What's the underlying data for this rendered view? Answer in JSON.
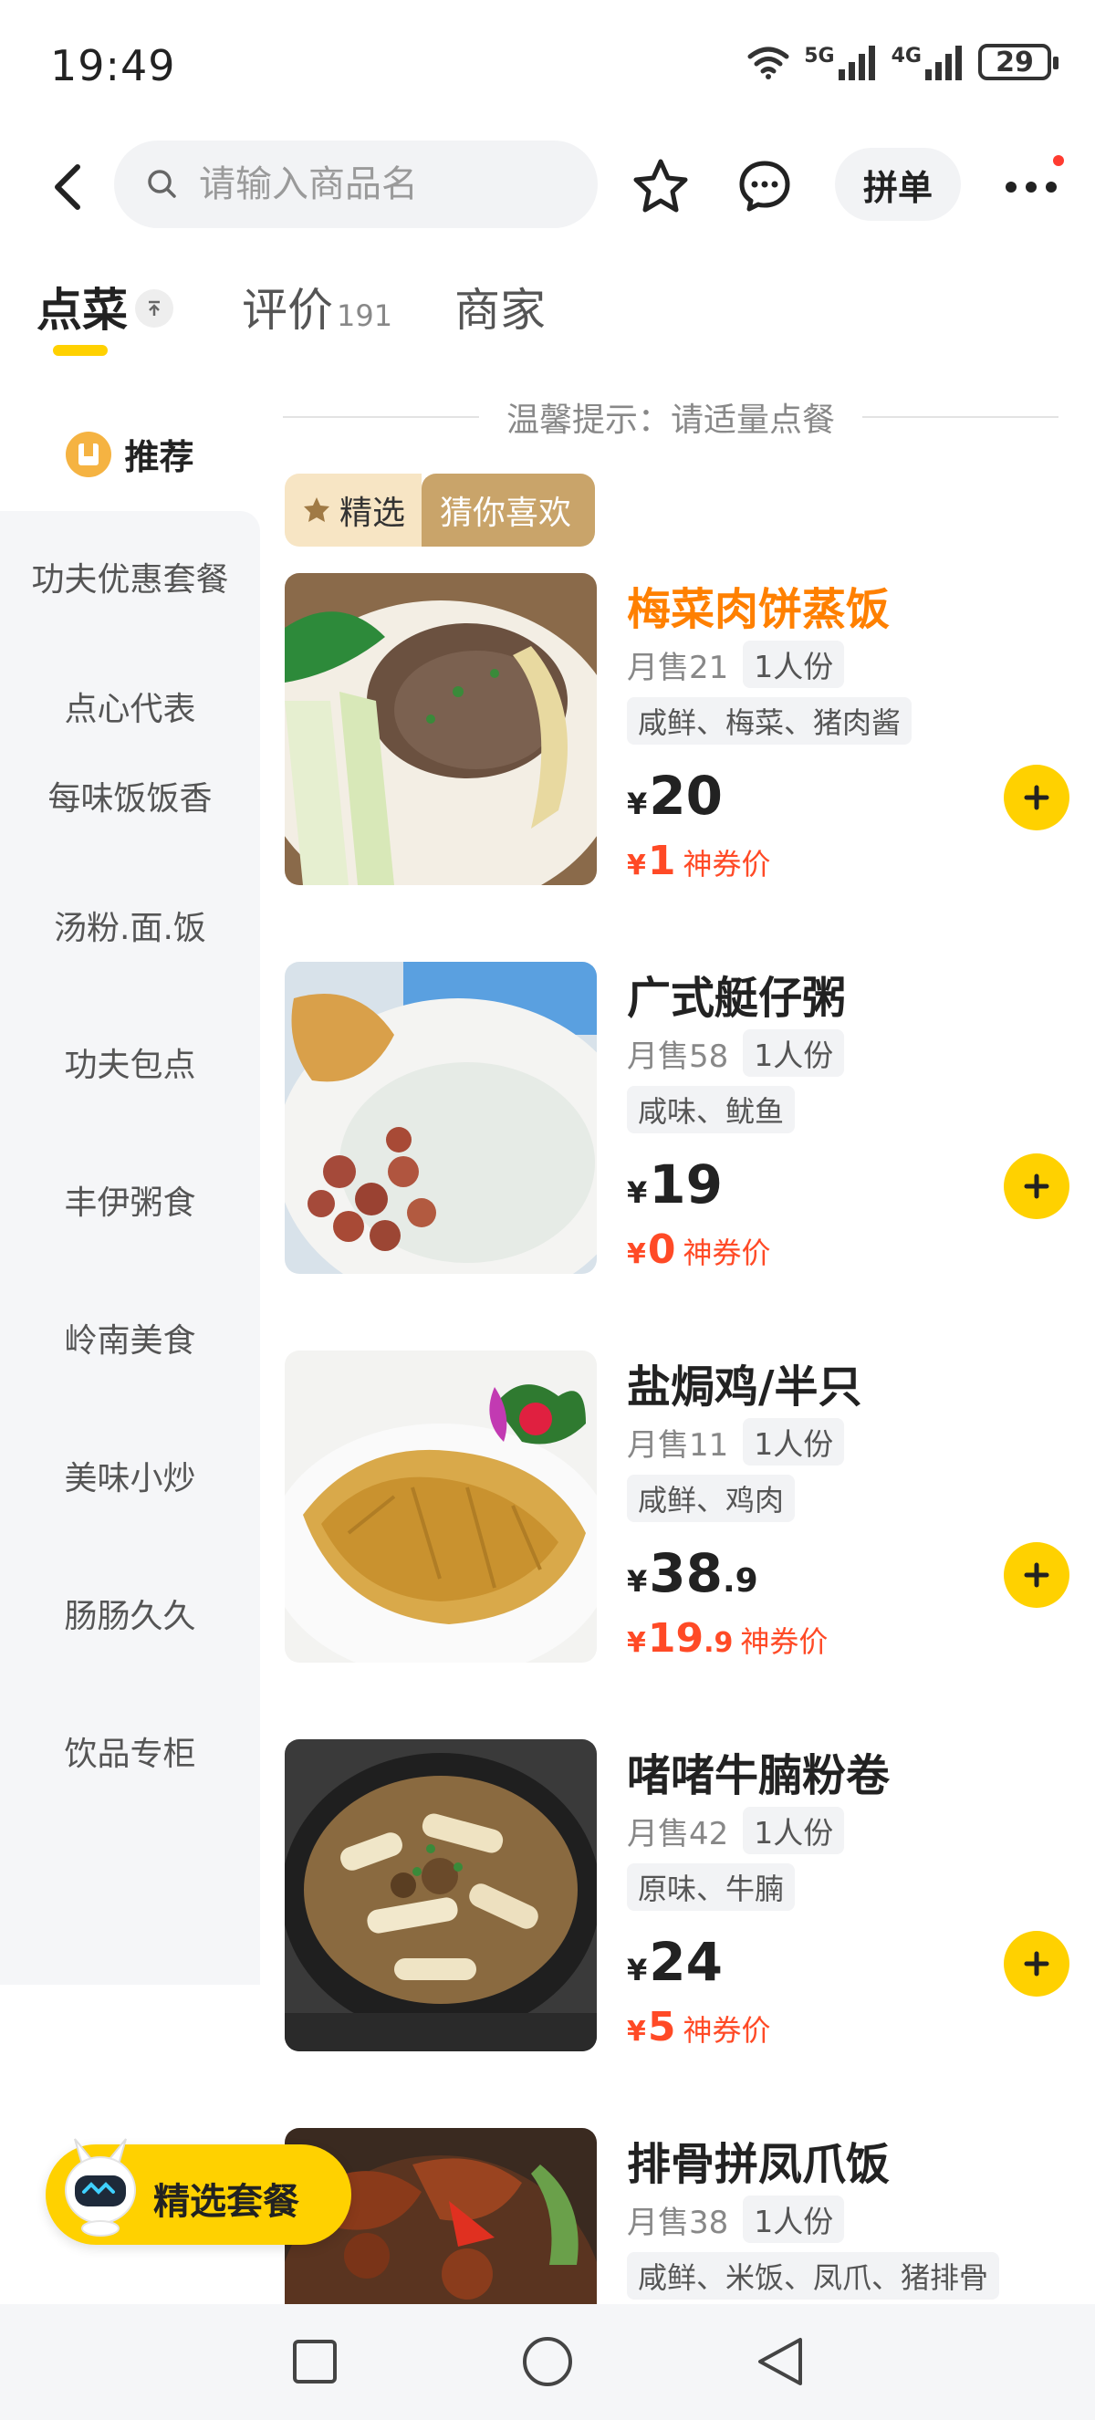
{
  "status_bar": {
    "time": "19:49",
    "battery": "29",
    "net_5g": "5G",
    "net_4g": "4G"
  },
  "nav": {
    "search_placeholder": "请输入商品名",
    "group_order": "拼单"
  },
  "tabs": [
    {
      "label": "点菜",
      "active": true
    },
    {
      "label": "评价",
      "count": "191"
    },
    {
      "label": "商家"
    }
  ],
  "sidebar": {
    "recommend": "推荐",
    "items": [
      "功夫优惠套餐",
      "点心代表",
      "每味饭饭香",
      "汤粉.面.饭",
      "功夫包点",
      "丰伊粥食",
      "岭南美食",
      "美味小炒",
      "肠肠久久",
      "饮品专柜"
    ]
  },
  "hint": "温馨提示：请适量点餐",
  "filter": {
    "selected": "精选",
    "guess": "猜你喜欢"
  },
  "dishes": [
    {
      "name": "梅菜肉饼蒸饭",
      "sold": "月售21",
      "portion": "1人份",
      "tags": "咸鲜、梅菜、猪肉酱",
      "yen": "¥",
      "price_int": "20",
      "price_dec": "",
      "coupon_int": "1",
      "coupon_dec": "",
      "coupon_label": "神券价"
    },
    {
      "name": "广式艇仔粥",
      "sold": "月售58",
      "portion": "1人份",
      "tags": "咸味、鱿鱼",
      "yen": "¥",
      "price_int": "19",
      "price_dec": "",
      "coupon_int": "0",
      "coupon_dec": "",
      "coupon_label": "神券价"
    },
    {
      "name": "盐焗鸡/半只",
      "sold": "月售11",
      "portion": "1人份",
      "tags": "咸鲜、鸡肉",
      "yen": "¥",
      "price_int": "38",
      "price_dec": ".9",
      "coupon_int": "19",
      "coupon_dec": ".9",
      "coupon_label": "神券价"
    },
    {
      "name": "啫啫牛腩粉卷",
      "sold": "月售42",
      "portion": "1人份",
      "tags": "原味、牛腩",
      "yen": "¥",
      "price_int": "24",
      "price_dec": "",
      "coupon_int": "5",
      "coupon_dec": "",
      "coupon_label": "神券价"
    },
    {
      "name": "排骨拼凤爪饭",
      "sold": "月售38",
      "portion": "1人份",
      "tags": "咸鲜、米饭、凤爪、猪排骨"
    }
  ],
  "combo": {
    "label": "精选套餐"
  },
  "colors": {
    "accent": "#ffd100",
    "highlight": "#ff8000",
    "coupon": "#ff4a26"
  }
}
